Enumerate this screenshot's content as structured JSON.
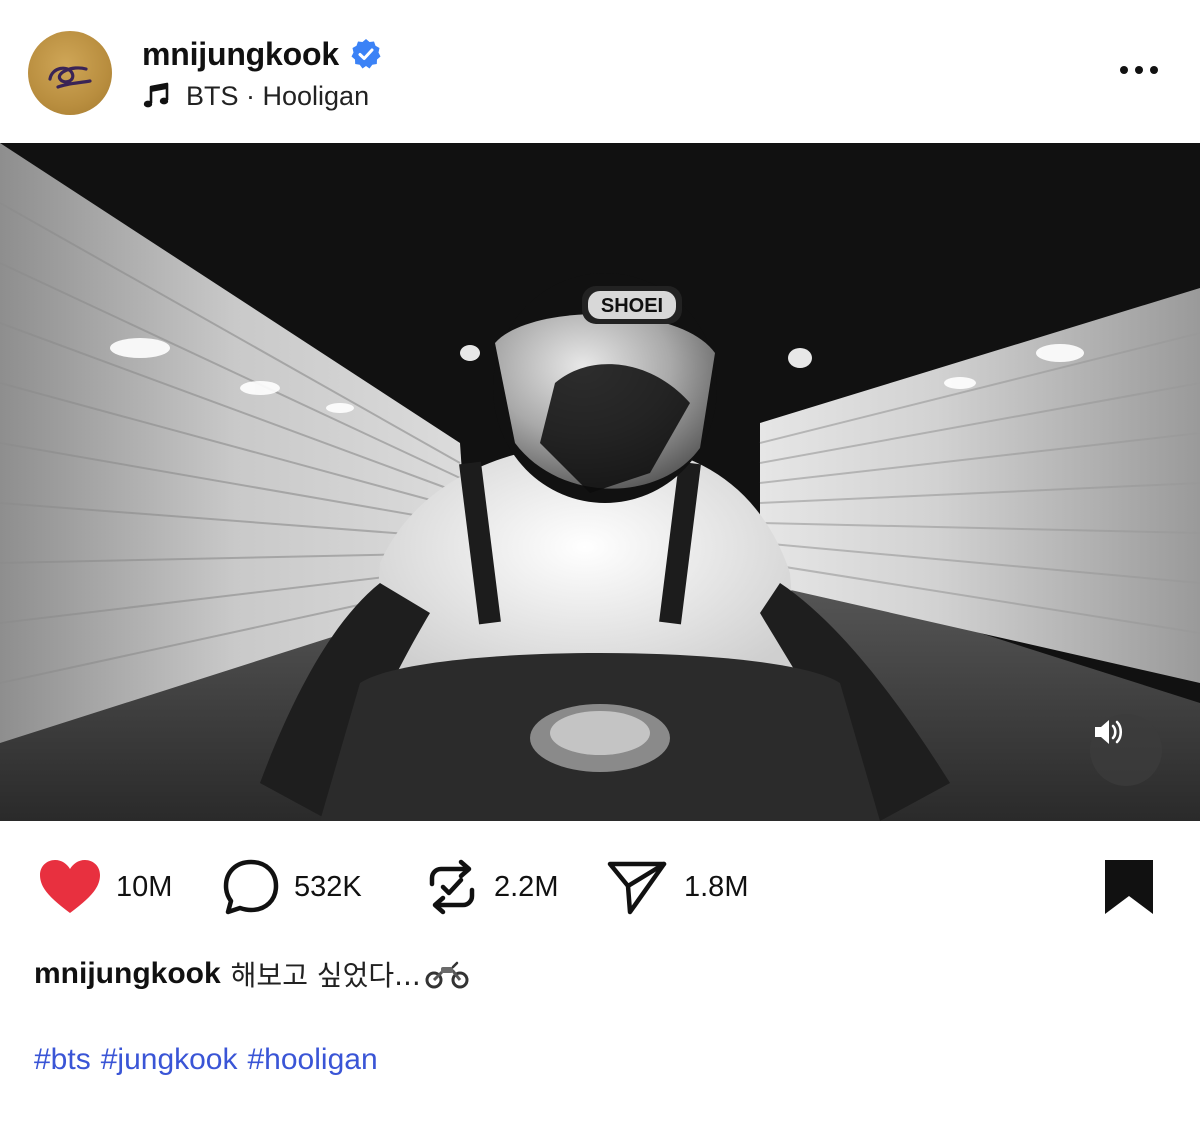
{
  "post": {
    "author": {
      "username": "mnijungkook",
      "verified": true,
      "avatar_icon": "golden-script-logo-icon"
    },
    "music": {
      "icon": "music-note-icon",
      "label": "BTS · Hooligan"
    },
    "more_icon": "more-horizontal-icon",
    "media": {
      "type": "video",
      "description_icon": "video-frame",
      "sound_icon": "speaker-volume-icon"
    },
    "actions": {
      "likes": "10M",
      "comments": "532K",
      "reposts": "2.2M",
      "shares": "1.8M",
      "like_icon": "heart-icon",
      "comment_icon": "comment-bubble-icon",
      "repost_icon": "repost-icon",
      "share_icon": "send-icon",
      "bookmark_icon": "bookmark-icon"
    },
    "caption": {
      "username": "mnijungkook",
      "text": "해보고 싶었다...",
      "emoji_icon": "motorcycle-icon"
    },
    "hashtags": [
      "#bts",
      "#jungkook",
      "#hooligan"
    ]
  },
  "colors": {
    "like": "#e8303f",
    "hashtag": "#3a55d6",
    "verified": "#3b82f6",
    "avatar_gold": "#b98e3f"
  }
}
